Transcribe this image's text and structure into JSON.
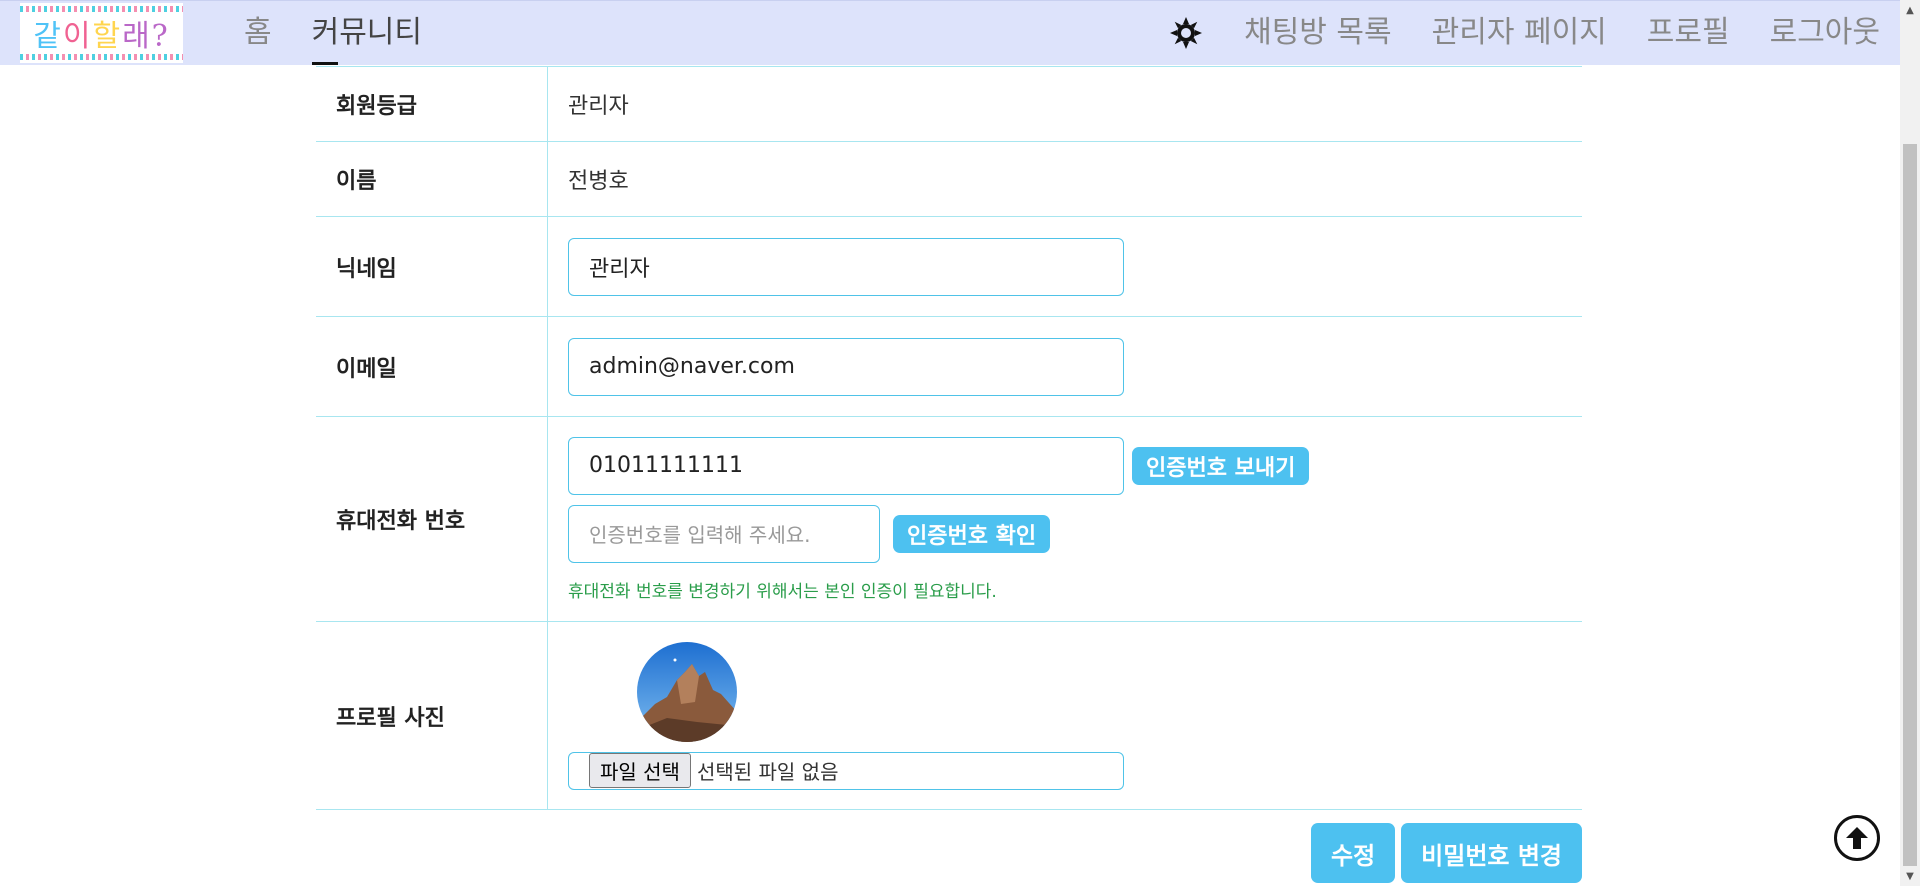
{
  "header": {
    "logo_text": [
      "같",
      "이 ",
      "할",
      "래?"
    ],
    "nav_left": [
      "홈",
      "커뮤니티"
    ],
    "nav_right": [
      "채팅방 목록",
      "관리자 페이지",
      "프로필",
      "로그아웃"
    ],
    "theme_icon": "gear-sun-icon"
  },
  "form": {
    "grade": {
      "label": "회원등급",
      "value": "관리자"
    },
    "name": {
      "label": "이름",
      "value": "전병호"
    },
    "nickname": {
      "label": "닉네임",
      "value": "관리자"
    },
    "email": {
      "label": "이메일",
      "value": "admin@naver.com"
    },
    "phone": {
      "label": "휴대전화 번호",
      "value": "01011111111",
      "send_button": "인증번호 보내기",
      "code_placeholder": "인증번호를 입력해 주세요.",
      "confirm_button": "인증번호 확인",
      "helper": "휴대전화 번호를 변경하기 위해서는 본인 인증이 필요합니다."
    },
    "photo": {
      "label": "프로필 사진",
      "file_button": "파일 선택",
      "file_status": "선택된 파일 없음"
    }
  },
  "actions": {
    "edit": "수정",
    "password": "비밀번호 변경"
  },
  "colors": {
    "accent": "#4dc1f0",
    "header_bg": "#dde3fb",
    "helper": "#2a9d4a"
  }
}
